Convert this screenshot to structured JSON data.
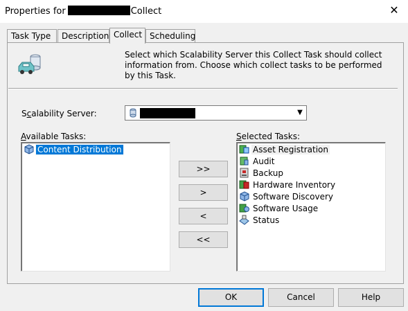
{
  "window": {
    "title_prefix": "Properties for",
    "title_suffix": "Collect",
    "close_glyph": "✕"
  },
  "tabs": [
    {
      "label": "Task Type",
      "active": false
    },
    {
      "label": "Description",
      "active": false
    },
    {
      "label": "Collect",
      "active": true
    },
    {
      "label": "Scheduling",
      "active": false
    }
  ],
  "header": {
    "description": "Select which Scalability Server this Collect Task should collect information from. Choose which collect tasks to be performed by this Task.",
    "icon": "car-database-icon"
  },
  "scalability_server": {
    "label_pre": "S",
    "label_ul": "c",
    "label_post": "alability Server:",
    "dropdown_arrow": "▼"
  },
  "available_tasks": {
    "label_ul": "A",
    "label_post": "vailable Tasks:",
    "items": [
      {
        "label": "Content Distribution",
        "icon": "package-icon",
        "selected": true
      }
    ]
  },
  "selected_tasks": {
    "label_ul": "S",
    "label_post": "elected Tasks:",
    "items": [
      {
        "label": "Asset Registration",
        "icon": "asset-icon"
      },
      {
        "label": "Audit",
        "icon": "audit-icon"
      },
      {
        "label": "Backup",
        "icon": "backup-icon"
      },
      {
        "label": "Hardware Inventory",
        "icon": "hardware-icon"
      },
      {
        "label": "Software Discovery",
        "icon": "discovery-icon"
      },
      {
        "label": "Software Usage",
        "icon": "usage-icon"
      },
      {
        "label": "Status",
        "icon": "status-icon"
      }
    ]
  },
  "move_buttons": {
    "add_all": ">>",
    "add": ">",
    "remove": "<",
    "remove_all": "<<"
  },
  "footer": {
    "ok": "OK",
    "cancel": "Cancel",
    "help": "Help"
  }
}
